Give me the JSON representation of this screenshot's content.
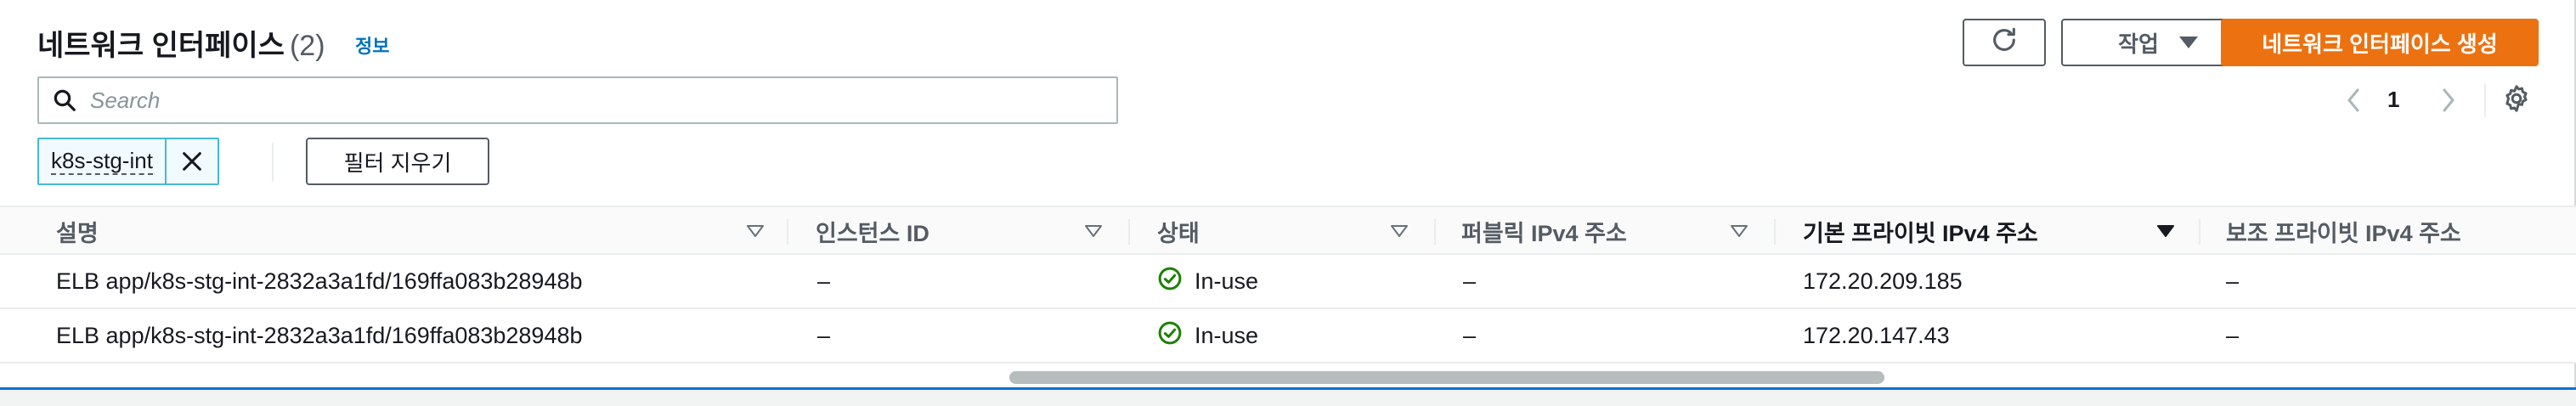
{
  "header": {
    "title": "네트워크 인터페이스",
    "count": "(2)",
    "info_link": "정보",
    "actions_label": "작업",
    "create_label": "네트워크 인터페이스 생성"
  },
  "search": {
    "placeholder": "Search",
    "value": ""
  },
  "pagination": {
    "current_page": "1"
  },
  "filter": {
    "token_label": "k8s-stg-int",
    "clear_label": "필터 지우기"
  },
  "table": {
    "columns": [
      {
        "label": "설명",
        "sort": "none"
      },
      {
        "label": "인스턴스 ID",
        "sort": "none"
      },
      {
        "label": "상태",
        "sort": "none"
      },
      {
        "label": "퍼블릭 IPv4 주소",
        "sort": "none"
      },
      {
        "label": "기본 프라이빗 IPv4 주소",
        "sort": "descending"
      },
      {
        "label": "보조 프라이빗 IPv4 주소",
        "sort": "none"
      }
    ],
    "rows": [
      {
        "description": "ELB app/k8s-stg-int-2832a3a1fd/169ffa083b28948b",
        "instance_id": "–",
        "status": "In-use",
        "public_ipv4": "–",
        "primary_private_ipv4": "172.20.209.185",
        "secondary_private_ipv4": "–"
      },
      {
        "description": "ELB app/k8s-stg-int-2832a3a1fd/169ffa083b28948b",
        "instance_id": "–",
        "status": "In-use",
        "public_ipv4": "–",
        "primary_private_ipv4": "172.20.147.43",
        "secondary_private_ipv4": "–"
      }
    ]
  },
  "colors": {
    "primary": "#ec7211",
    "link": "#0073bb",
    "success": "#1d8102",
    "token_border": "#44b9d6",
    "selection": "#0972d3"
  },
  "icons": {
    "refresh": "refresh-icon",
    "search": "search-icon",
    "settings": "gear-icon",
    "status_ok": "check-circle-icon",
    "token_remove": "close-icon",
    "sort": "caret-down-icon"
  }
}
